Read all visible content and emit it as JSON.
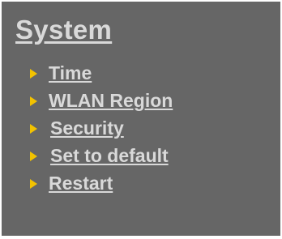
{
  "panel": {
    "title": "System",
    "items": [
      {
        "label": "Time"
      },
      {
        "label": "WLAN Region"
      },
      {
        "label": "Security"
      },
      {
        "label": "Set to default"
      },
      {
        "label": "Restart"
      }
    ]
  },
  "colors": {
    "panel_bg": "#666666",
    "text": "#d9d9d9",
    "arrow": "#f2c200"
  }
}
